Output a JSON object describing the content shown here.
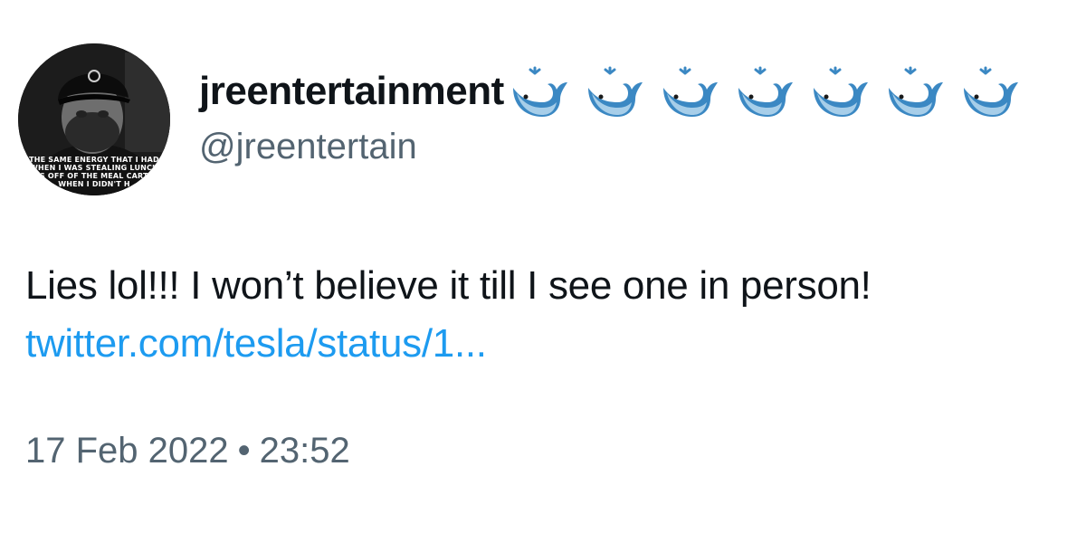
{
  "tweet": {
    "display_name": "jreentertainment",
    "name_emoji": [
      "whale-icon",
      "whale-icon",
      "whale-icon",
      "whale-icon",
      "whale-icon",
      "whale-icon",
      "whale-icon"
    ],
    "handle": "@jreentertain",
    "avatar_caption": "THE SAME ENERGY THAT I HAD\nWHEN I WAS STEALING LUNCH\nES OFF OF THE MEAL CARTS\nWHEN I DIDN'T H",
    "text": "Lies lol!!! I won’t believe it till I see one in person!",
    "link": "twitter.com/tesla/status/1...",
    "date": "17 Feb 2022",
    "separator": "•",
    "time": "23:52"
  },
  "colors": {
    "link": "#1d9bf0",
    "secondary_text": "#536471",
    "primary_text": "#0f1419",
    "whale": "#3b88c3"
  }
}
